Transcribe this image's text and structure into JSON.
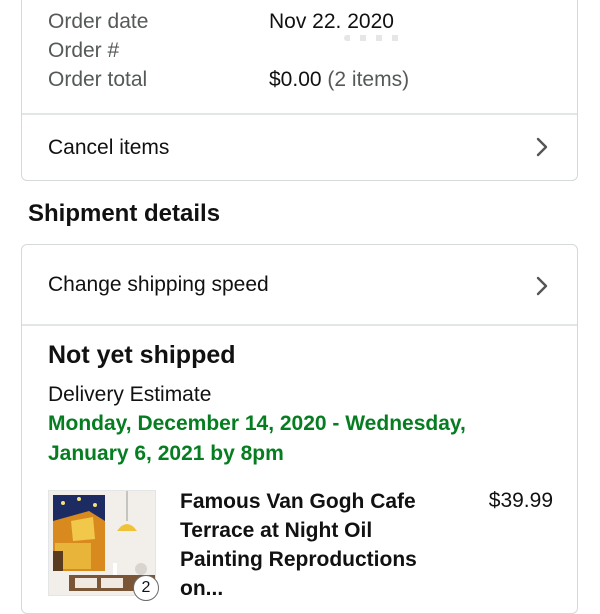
{
  "order": {
    "date_label": "Order date",
    "date_value": "Nov 22. 2020",
    "number_label": "Order #",
    "total_label": "Order total",
    "total_value": "$0.00",
    "total_items": "(2 items)"
  },
  "actions": {
    "cancel_items": "Cancel items",
    "change_shipping": "Change shipping speed"
  },
  "shipment": {
    "section_title": "Shipment details",
    "status": "Not yet shipped",
    "estimate_label": "Delivery Estimate",
    "estimate_dates": "Monday, December 14, 2020 - Wednesday, January 6, 2021 by 8pm",
    "estimate_color": "#067d20",
    "item": {
      "title": "Famous Van Gogh Cafe Terrace at Night Oil Painting Reproductions on...",
      "price": "$39.99",
      "quantity": "2"
    }
  },
  "icons": {
    "row_chevron": "chevron-right-icon"
  }
}
